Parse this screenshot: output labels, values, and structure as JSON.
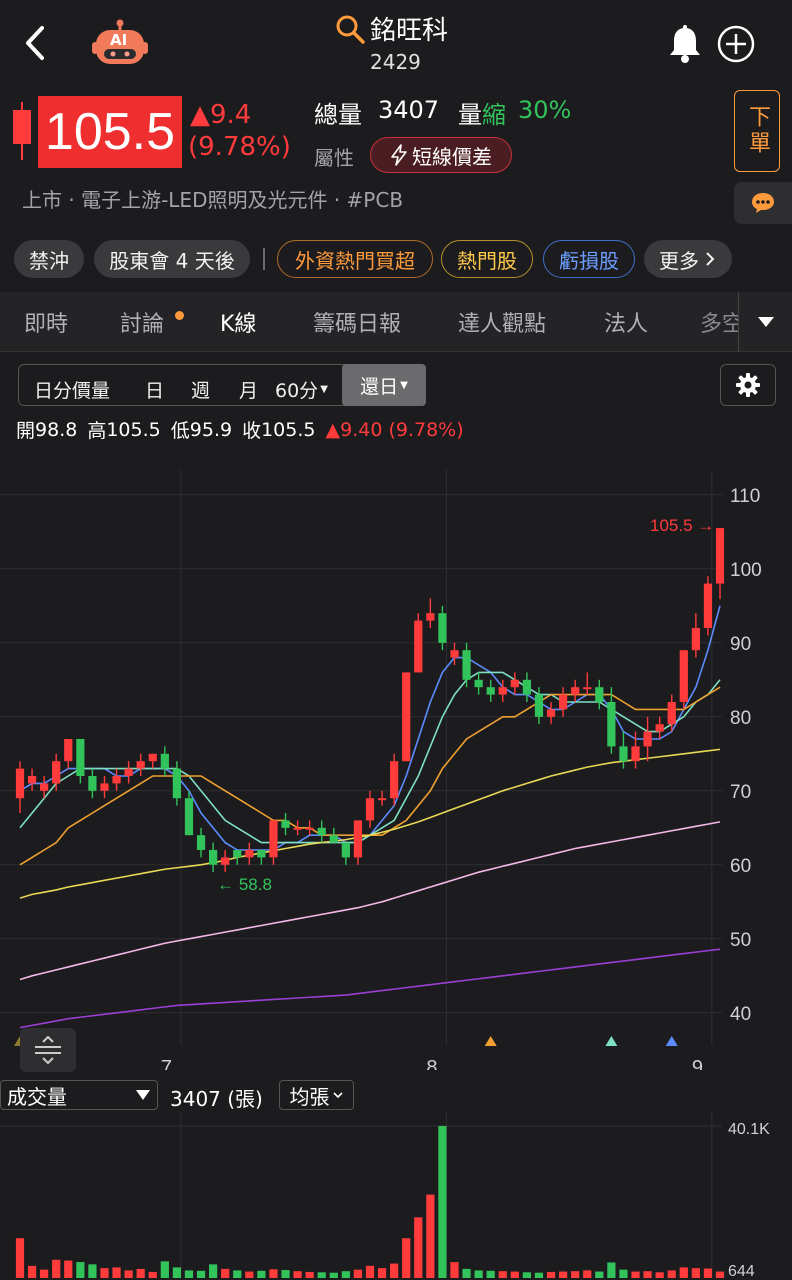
{
  "header": {
    "title": "銘旺科",
    "code": "2429",
    "ai_label": "AI"
  },
  "quote": {
    "price": "105.5",
    "change": "▲9.4",
    "change_pct": "(9.78%)",
    "volume_label": "總量",
    "volume_value": "3407",
    "ratio_label": "量縮",
    "ratio_label_a": "量",
    "ratio_label_b": "縮",
    "ratio_value": "30%",
    "attr_label": "屬性",
    "attr_tag": "短線價差",
    "order_button": "下單"
  },
  "industry": "上市 · 電子上游-LED照明及光元件 · #PCB",
  "chips": [
    "禁沖",
    "股東會 4 天後",
    "外資熱門買超",
    "熱門股",
    "虧損股",
    "更多"
  ],
  "tabs": [
    "即時",
    "討論",
    "K線",
    "籌碼日報",
    "達人觀點",
    "法人",
    "多空"
  ],
  "active_tab": "K線",
  "periods": [
    "日分價量",
    "日",
    "週",
    "月",
    "60分",
    "還日"
  ],
  "ohlc": {
    "open_label": "開",
    "open": "98.8",
    "high_label": "高",
    "high": "105.5",
    "low_label": "低",
    "low": "95.9",
    "close_label": "收",
    "close": "105.5",
    "change": "▲9.40 (9.78%)"
  },
  "volume_panel": {
    "selector": "成交量",
    "value": "3407 (張)",
    "mode": "均張",
    "max_label": "40.1K",
    "min_label": "644"
  },
  "colors": {
    "up": "#ff3b3b",
    "down": "#32c35a",
    "accent": "#ff9a3c",
    "bg": "#1c1c1e"
  },
  "chart_data": {
    "type": "candlestick",
    "y_ticks": [
      "110",
      "100",
      "90",
      "80",
      "70",
      "60",
      "50",
      "40"
    ],
    "ylim": [
      37,
      112
    ],
    "x_ticks": [
      {
        "label": "7",
        "index": 12
      },
      {
        "label": "8",
        "index": 34
      },
      {
        "label": "9",
        "index": 56
      }
    ],
    "high_marker": "105.5",
    "low_marker": "58.8",
    "candles": [
      [
        69,
        73,
        67,
        74
      ],
      [
        71,
        72,
        70,
        73
      ],
      [
        70,
        71,
        69,
        72
      ],
      [
        71,
        74,
        70,
        75
      ],
      [
        74,
        77,
        73,
        77
      ],
      [
        77,
        72,
        71,
        77
      ],
      [
        72,
        70,
        69,
        73
      ],
      [
        70,
        71,
        69,
        72
      ],
      [
        71,
        72,
        70,
        73
      ],
      [
        72,
        73,
        71,
        74
      ],
      [
        73,
        74,
        72,
        75
      ],
      [
        74,
        75,
        73,
        75
      ],
      [
        75,
        73,
        72,
        76
      ],
      [
        73,
        69,
        68,
        74
      ],
      [
        69,
        64,
        64,
        70
      ],
      [
        64,
        62,
        61,
        65
      ],
      [
        62,
        60,
        59,
        63
      ],
      [
        60,
        61,
        59,
        62
      ],
      [
        62,
        61,
        60,
        62
      ],
      [
        61,
        62,
        60,
        63
      ],
      [
        62,
        61,
        60,
        62
      ],
      [
        61,
        66,
        60,
        66
      ],
      [
        66,
        65,
        64,
        67
      ],
      [
        65,
        65,
        64,
        66
      ],
      [
        65,
        65,
        64,
        66
      ],
      [
        65,
        64,
        63,
        66
      ],
      [
        64,
        63,
        63,
        65
      ],
      [
        63,
        61,
        60,
        63
      ],
      [
        61,
        66,
        60,
        66
      ],
      [
        66,
        69,
        65,
        70
      ],
      [
        69,
        69,
        68,
        70
      ],
      [
        69,
        74,
        68,
        75
      ],
      [
        74,
        86,
        74,
        86
      ],
      [
        86,
        93,
        86,
        94
      ],
      [
        93,
        94,
        92,
        96
      ],
      [
        94,
        90,
        89,
        95
      ],
      [
        88,
        89,
        87,
        90
      ],
      [
        89,
        85,
        84,
        90
      ],
      [
        85,
        84,
        83,
        86
      ],
      [
        84,
        83,
        82,
        85
      ],
      [
        83,
        84,
        82,
        85
      ],
      [
        84,
        85,
        83,
        86
      ],
      [
        85,
        83,
        82,
        86
      ],
      [
        83,
        80,
        79,
        84
      ],
      [
        80,
        81,
        79,
        82
      ],
      [
        81,
        83,
        80,
        84
      ],
      [
        83,
        84,
        82,
        85
      ],
      [
        84,
        84,
        83,
        86
      ],
      [
        84,
        82,
        81,
        85
      ],
      [
        82,
        76,
        75,
        84
      ],
      [
        76,
        74,
        73,
        78
      ],
      [
        74,
        76,
        73,
        78
      ],
      [
        76,
        78,
        74,
        80
      ],
      [
        78,
        79,
        77,
        80
      ],
      [
        79,
        82,
        78,
        83
      ],
      [
        82,
        89,
        81,
        89
      ],
      [
        89,
        92,
        88,
        94
      ],
      [
        92,
        98,
        91,
        99
      ],
      [
        98,
        105.5,
        95.9,
        105.5
      ]
    ],
    "ma_lines": [
      {
        "color": "#5d8cff",
        "values": [
          70,
          71,
          71,
          72,
          73,
          73,
          73,
          73,
          72,
          72,
          73,
          73,
          73,
          72,
          70,
          67,
          65,
          63,
          62,
          62,
          62,
          62,
          63,
          63,
          64,
          64,
          64,
          63,
          63,
          64,
          66,
          68,
          72,
          77,
          82,
          86,
          88,
          88,
          87,
          86,
          84,
          83,
          83,
          82,
          81,
          81,
          82,
          83,
          83,
          81,
          78,
          77,
          77,
          77,
          78,
          81,
          84,
          89,
          95
        ]
      },
      {
        "color": "#7de0c2",
        "values": [
          65,
          67,
          69,
          71,
          72,
          73,
          73,
          73,
          73,
          73,
          73,
          73,
          73,
          73,
          72,
          70,
          68,
          66,
          65,
          64,
          63,
          63,
          63,
          63,
          63,
          63,
          63,
          63,
          63,
          64,
          65,
          66,
          69,
          72,
          76,
          80,
          83,
          85,
          86,
          86,
          86,
          85,
          84,
          83,
          83,
          82,
          82,
          82,
          82,
          81,
          80,
          79,
          78,
          78,
          79,
          80,
          82,
          83,
          85
        ]
      },
      {
        "color": "#f0a030",
        "values": [
          60,
          61,
          62,
          63,
          65,
          66,
          67,
          68,
          69,
          70,
          71,
          72,
          72,
          72,
          72,
          72,
          71,
          70,
          69,
          68,
          67,
          66,
          66,
          65,
          65,
          64,
          64,
          64,
          64,
          64,
          64,
          65,
          66,
          68,
          70,
          73,
          75,
          77,
          78,
          79,
          80,
          80,
          81,
          82,
          83,
          83,
          83,
          83,
          83,
          83,
          82,
          81,
          81,
          81,
          81,
          81,
          82,
          83,
          84
        ]
      },
      {
        "color": "#e8d855",
        "values": [
          55.5,
          56,
          56.3,
          56.6,
          57,
          57.3,
          57.6,
          57.9,
          58.2,
          58.5,
          58.8,
          59.1,
          59.4,
          59.6,
          59.8,
          60,
          60.3,
          60.6,
          61,
          61.3,
          61.6,
          61.9,
          62.2,
          62.5,
          62.8,
          63,
          63.2,
          63.4,
          63.7,
          64,
          64.4,
          64.8,
          65.3,
          65.8,
          66.4,
          67,
          67.6,
          68.2,
          68.8,
          69.4,
          70,
          70.5,
          71,
          71.5,
          72,
          72.4,
          72.8,
          73.2,
          73.5,
          73.8,
          74,
          74.2,
          74.4,
          74.6,
          74.8,
          75,
          75.2,
          75.4,
          75.6
        ]
      },
      {
        "color": "#f4b8e8",
        "values": [
          44.5,
          45,
          45.4,
          45.8,
          46.2,
          46.6,
          47,
          47.4,
          47.8,
          48.2,
          48.6,
          49,
          49.4,
          49.7,
          50,
          50.3,
          50.6,
          50.9,
          51.2,
          51.5,
          51.8,
          52.1,
          52.4,
          52.7,
          53,
          53.3,
          53.6,
          53.9,
          54.2,
          54.6,
          55,
          55.5,
          56,
          56.5,
          57,
          57.5,
          58,
          58.5,
          59,
          59.4,
          59.8,
          60.2,
          60.6,
          61,
          61.4,
          61.8,
          62.2,
          62.5,
          62.8,
          63.1,
          63.4,
          63.7,
          64,
          64.3,
          64.6,
          64.9,
          65.2,
          65.5,
          65.8
        ]
      },
      {
        "color": "#9b3fd6",
        "values": [
          38,
          38.3,
          38.6,
          38.9,
          39.2,
          39.4,
          39.6,
          39.8,
          40,
          40.2,
          40.4,
          40.6,
          40.8,
          41,
          41.1,
          41.2,
          41.3,
          41.4,
          41.5,
          41.6,
          41.7,
          41.8,
          41.9,
          42,
          42.1,
          42.2,
          42.3,
          42.4,
          42.6,
          42.8,
          43,
          43.2,
          43.4,
          43.6,
          43.8,
          44,
          44.2,
          44.4,
          44.6,
          44.8,
          45,
          45.2,
          45.4,
          45.6,
          45.8,
          46,
          46.2,
          46.4,
          46.6,
          46.8,
          47,
          47.2,
          47.4,
          47.6,
          47.8,
          48,
          48.2,
          48.4,
          48.6
        ]
      }
    ],
    "volumes": [
      10500,
      3200,
      2200,
      4800,
      4600,
      4200,
      3600,
      2600,
      2800,
      2000,
      2400,
      1600,
      4400,
      2800,
      2000,
      1900,
      3600,
      2400,
      2000,
      1700,
      1900,
      2300,
      2100,
      1800,
      1600,
      1500,
      1400,
      1800,
      2200,
      3200,
      2600,
      3800,
      10500,
      16000,
      22000,
      40100,
      4200,
      2400,
      2000,
      1900,
      1800,
      1700,
      1500,
      1400,
      1600,
      1700,
      1800,
      2000,
      1700,
      4100,
      2200,
      1700,
      1800,
      1500,
      2000,
      2800,
      2600,
      2500,
      1700
    ],
    "event_markers": [
      {
        "index": 0,
        "color": "#8c7a2a"
      },
      {
        "index": 39,
        "color": "#f0a030"
      },
      {
        "index": 49,
        "color": "#7de0c2"
      },
      {
        "index": 54,
        "color": "#5d8cff"
      }
    ]
  }
}
